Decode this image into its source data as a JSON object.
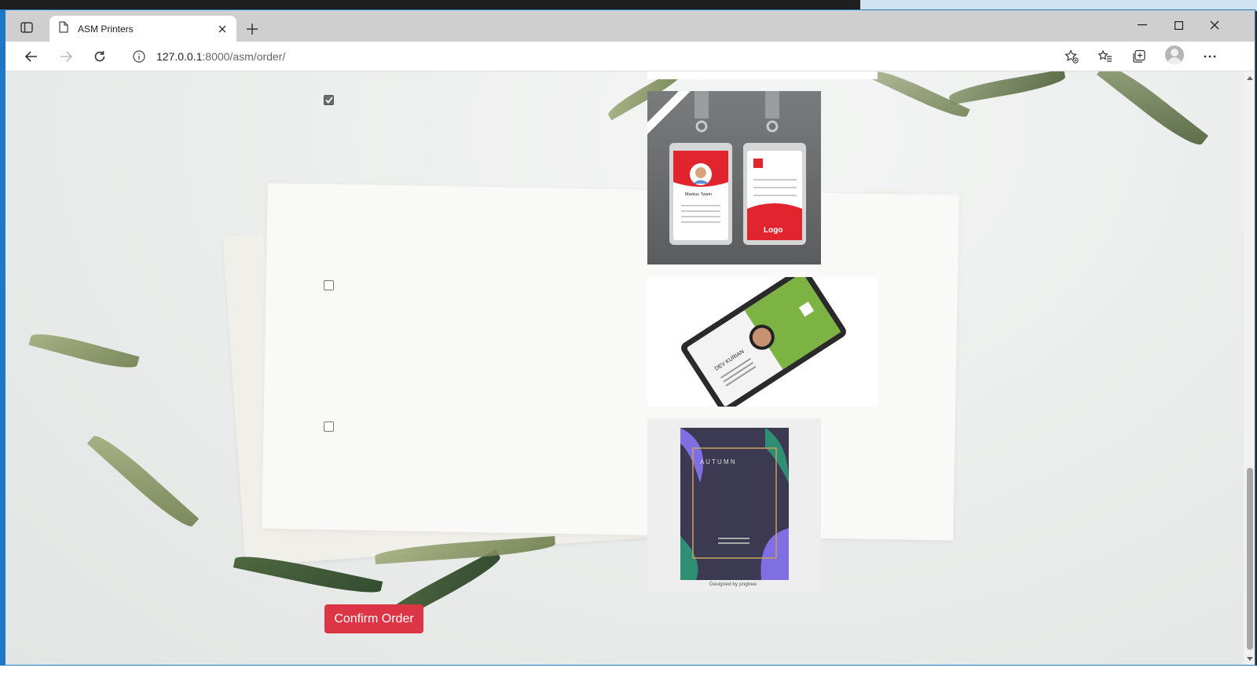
{
  "browser": {
    "tab_title": "ASM Printers",
    "url_host": "127.0.0.1",
    "url_rest": ":8000/asm/order/"
  },
  "order_items": [
    {
      "checked": true,
      "image": "id-card-red-lanyard"
    },
    {
      "checked": false,
      "image": "id-card-green-holder"
    },
    {
      "checked": false,
      "image": "autumn-poster"
    }
  ],
  "card_text": {
    "card1_name": "Markus Twain",
    "card1_logo": "Logo",
    "card2_name": "DEV KURIAN",
    "card3_title": "A U T U M N",
    "card3_credit": "Designed by pngtree"
  },
  "actions": {
    "confirm_label": "Confirm Order"
  },
  "colors": {
    "confirm_button": "#dc3545"
  }
}
